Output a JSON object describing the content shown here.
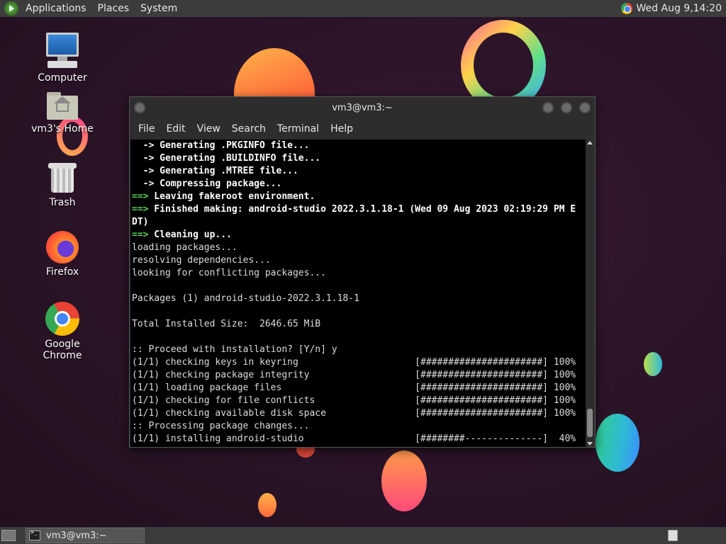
{
  "top_panel": {
    "menus": [
      "Applications",
      "Places",
      "System"
    ],
    "clock": "Wed Aug  9,14:20"
  },
  "desktop_icons": [
    {
      "label": "Computer",
      "icon": "computer-icon"
    },
    {
      "label": "vm3's Home",
      "icon": "home-folder-icon"
    },
    {
      "label": "Trash",
      "icon": "trash-icon"
    },
    {
      "label": "Firefox",
      "icon": "firefox-icon"
    },
    {
      "label": "Google Chrome",
      "icon": "chrome-icon"
    }
  ],
  "terminal": {
    "title": "vm3@vm3:~",
    "menus": [
      "File",
      "Edit",
      "View",
      "Search",
      "Terminal",
      "Help"
    ],
    "lines": [
      {
        "style": "sub",
        "text": "  -> Generating .PKGINFO file..."
      },
      {
        "style": "sub",
        "text": "  -> Generating .BUILDINFO file..."
      },
      {
        "style": "sub",
        "text": "  -> Generating .MTREE file..."
      },
      {
        "style": "sub",
        "text": "  -> Compressing package..."
      },
      {
        "style": "main",
        "text": "==> Leaving fakeroot environment."
      },
      {
        "style": "main",
        "text": "==> Finished making: android-studio 2022.3.1.18-1 (Wed 09 Aug 2023 02:19:29 PM E"
      },
      {
        "style": "bold",
        "text": "DT)"
      },
      {
        "style": "main",
        "text": "==> Cleaning up..."
      },
      {
        "style": "plain",
        "text": "loading packages..."
      },
      {
        "style": "plain",
        "text": "resolving dependencies..."
      },
      {
        "style": "plain",
        "text": "looking for conflicting packages..."
      },
      {
        "style": "plain",
        "text": ""
      },
      {
        "style": "plain",
        "text": "Packages (1) android-studio-2022.3.1.18-1"
      },
      {
        "style": "plain",
        "text": ""
      },
      {
        "style": "plain",
        "text": "Total Installed Size:  2646.65 MiB"
      },
      {
        "style": "plain",
        "text": ""
      },
      {
        "style": "plain",
        "text": ":: Proceed with installation? [Y/n] y"
      },
      {
        "style": "plain",
        "text": "(1/1) checking keys in keyring                     [######################] 100%"
      },
      {
        "style": "plain",
        "text": "(1/1) checking package integrity                   [######################] 100%"
      },
      {
        "style": "plain",
        "text": "(1/1) loading package files                        [######################] 100%"
      },
      {
        "style": "plain",
        "text": "(1/1) checking for file conflicts                  [######################] 100%"
      },
      {
        "style": "plain",
        "text": "(1/1) checking available disk space                [######################] 100%"
      },
      {
        "style": "plain",
        "text": ":: Processing package changes..."
      },
      {
        "style": "plain",
        "text": "(1/1) installing android-studio                    [########--------------]  40%"
      }
    ]
  },
  "taskbar": {
    "window_label": "vm3@vm3:~"
  }
}
